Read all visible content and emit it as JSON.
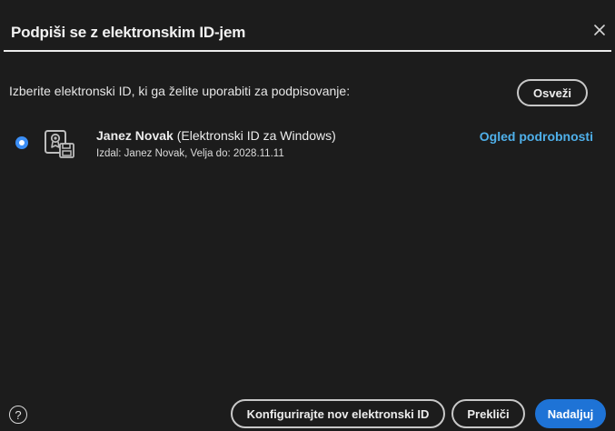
{
  "dialog": {
    "title": "Podpiši se z elektronskim ID-jem",
    "close_icon": "close-icon"
  },
  "instruction": "Izberite elektronski ID, ki ga želite uporabiti za podpisovanje:",
  "refresh_label": "Osveži",
  "digital_ids": [
    {
      "selected": true,
      "icon": "certificate-card-icon",
      "name": "Janez Novak",
      "type": "(Elektronski ID za Windows)",
      "details": "Izdal: Janez Novak, Velja do: 2028.11.11",
      "view_details_label": "Ogled podrobnosti"
    }
  ],
  "footer": {
    "help_icon": "help-icon",
    "help_glyph": "?",
    "configure_label": "Konfigurirajte nov elektronski ID",
    "cancel_label": "Prekliči",
    "continue_label": "Nadaljuj"
  },
  "colors": {
    "background": "#1c1c1c",
    "link": "#4fb0ea",
    "primary_button": "#1e73d6",
    "radio_selected": "#3b8ef5"
  }
}
